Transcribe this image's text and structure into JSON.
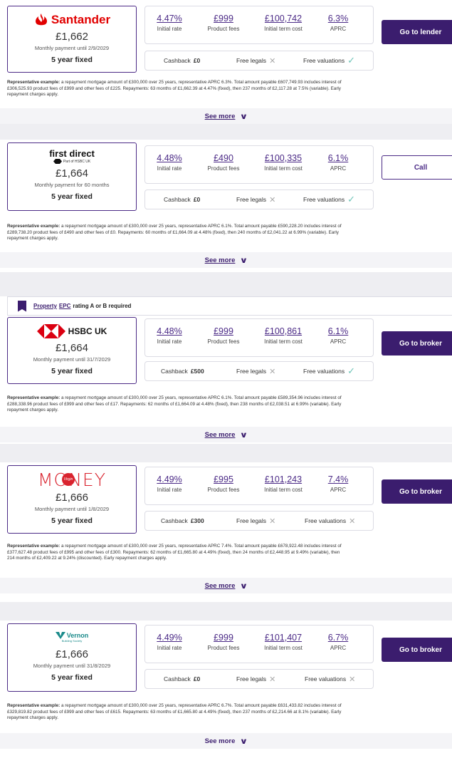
{
  "deals": [
    {
      "lender": "Santander",
      "amount": "£1,662",
      "monthly": "Monthly payment until 2/9/2029",
      "term": "5 year fixed",
      "stats": [
        {
          "value": "4.47%",
          "label": "Initial rate"
        },
        {
          "value": "£999",
          "label": "Product fees"
        },
        {
          "value": "£100,742",
          "label": "Initial term cost"
        },
        {
          "value": "6.3%",
          "label": "APRC"
        }
      ],
      "cashback_label": "Cashback",
      "cashback_value": "£0",
      "legals_label": "Free legals",
      "legals_icon": "x-icon",
      "valuations_label": "Free valuations",
      "valuations_icon": "check-icon",
      "cta": "Go to lender",
      "rep_title": "Representative example:",
      "rep_line1": " a repayment mortgage amount of £300,000 over 25 years, representative APRC 6.3%. Total amount payable £607,749.93 includes interest of",
      "rep_line2": "£306,525.93 product fees of £999 and other fees of £225. Repayments: 63 months of £1,662.39 at 4.47% (fixed), then 237 months of £2,117.28 at 7.5% (variable). Early",
      "rep_line3": "repayment charges apply.",
      "see_more": "See more"
    },
    {
      "lender": "first direct",
      "lender_sub": "Part of HSBC UK",
      "amount": "£1,664",
      "monthly": "Monthly payment for 60 months",
      "term": "5 year fixed",
      "stats": [
        {
          "value": "4.48%",
          "label": "Initial rate"
        },
        {
          "value": "£490",
          "label": "Product fees"
        },
        {
          "value": "£100,335",
          "label": "Initial term cost"
        },
        {
          "value": "6.1%",
          "label": "APRC"
        }
      ],
      "cashback_label": "Cashback",
      "cashback_value": "£0",
      "legals_label": "Free legals",
      "legals_icon": "x-icon",
      "valuations_label": "Free valuations",
      "valuations_icon": "check-icon",
      "cta": "Call",
      "rep_title": "Representative example:",
      "rep_line1": " a repayment mortgage amount of £300,000 over 25 years, representative APRC 6.1%. Total amount payable £590,228.20 includes interest of",
      "rep_line2": "£289,738.20 product fees of £490 and other fees of £0. Repayments: 60 months of £1,664.09 at 4.48% (fixed), then 240 months of £2,041.22 at 6.99% (variable). Early",
      "rep_line3": "repayment charges apply.",
      "see_more": "See more"
    },
    {
      "lender": "HSBC UK",
      "amount": "£1,664",
      "monthly": "Monthly payment until 31/7/2029",
      "term": "5 year fixed",
      "stats": [
        {
          "value": "4.48%",
          "label": "Initial rate"
        },
        {
          "value": "£999",
          "label": "Product fees"
        },
        {
          "value": "£100,861",
          "label": "Initial term cost"
        },
        {
          "value": "6.1%",
          "label": "APRC"
        }
      ],
      "cashback_label": "Cashback",
      "cashback_value": "£500",
      "legals_label": "Free legals",
      "legals_icon": "x-icon",
      "valuations_label": "Free valuations",
      "valuations_icon": "check-icon",
      "cta": "Go to broker",
      "rep_title": "Representative example:",
      "rep_line1": " a repayment mortgage amount of £300,000 over 25 years, representative APRC 6.1%. Total amount payable £589,354.96 includes interest of",
      "rep_line2": "£288,338.96 product fees of £999 and other fees of £17. Repayments: 62 months of £1,664.09 at 4.48% (fixed), then 238 months of £2,038.51 at 6.99% (variable). Early",
      "rep_line3": "repayment charges apply.",
      "see_more": "See more"
    },
    {
      "lender": "MONEY",
      "lender_sub": "Virgin",
      "amount": "£1,666",
      "monthly": "Monthly payment until 1/8/2029",
      "term": "5 year fixed",
      "stats": [
        {
          "value": "4.49%",
          "label": "Initial rate"
        },
        {
          "value": "£995",
          "label": "Product fees"
        },
        {
          "value": "£101,243",
          "label": "Initial term cost"
        },
        {
          "value": "7.4%",
          "label": "APRC"
        }
      ],
      "cashback_label": "Cashback",
      "cashback_value": "£300",
      "legals_label": "Free legals",
      "legals_icon": "x-icon",
      "valuations_label": "Free valuations",
      "valuations_icon": "x-icon",
      "cta": "Go to broker",
      "rep_title": "Representative example:",
      "rep_line1": " a repayment mortgage amount of £300,000 over 25 years, representative APRC 7.4%. Total amount payable £678,922.48 includes interest of",
      "rep_line2": "£377,627.48 product fees of £995 and other fees of £300. Repayments: 62 months of £1,665.80 at 4.49% (fixed), then 24 months of £2,448.95 at 9.49% (variable), then",
      "rep_line3": "214 months of £2,409.22 at 9.24% (discounted). Early repayment charges apply.",
      "see_more": "See more"
    },
    {
      "lender": "Vernon",
      "lender_sub": "Building Society",
      "amount": "£1,666",
      "monthly": "Monthly payment until 31/8/2029",
      "term": "5 year fixed",
      "stats": [
        {
          "value": "4.49%",
          "label": "Initial rate"
        },
        {
          "value": "£999",
          "label": "Product fees"
        },
        {
          "value": "£101,407",
          "label": "Initial term cost"
        },
        {
          "value": "6.7%",
          "label": "APRC"
        }
      ],
      "cashback_label": "Cashback",
      "cashback_value": "£0",
      "legals_label": "Free legals",
      "legals_icon": "x-icon",
      "valuations_label": "Free valuations",
      "valuations_icon": "x-icon",
      "cta": "Go to broker",
      "rep_title": "Representative example:",
      "rep_line1": " a repayment mortgage amount of £300,000 over 25 years, representative APRC 6.7%. Total amount payable £631,433.82 includes interest of",
      "rep_line2": "£329,819.82 product fees of £999 and other fees of £615. Repayments: 63 months of £1,665.80 at 4.49% (fixed), then 237 months of £2,214.66 at 8.1% (variable). Early",
      "rep_line3": "repayment charges apply.",
      "see_more": "See more"
    }
  ],
  "epc_banner": {
    "link1": "Property",
    "link2": "EPC",
    "text": "rating A or B required"
  },
  "colors": {
    "brand_purple": "#3b1d6e",
    "santander_red": "#e10000",
    "virgin_red": "#d9232e",
    "vernon_teal": "#1a8a8a",
    "check_teal": "#6fc4b8"
  }
}
